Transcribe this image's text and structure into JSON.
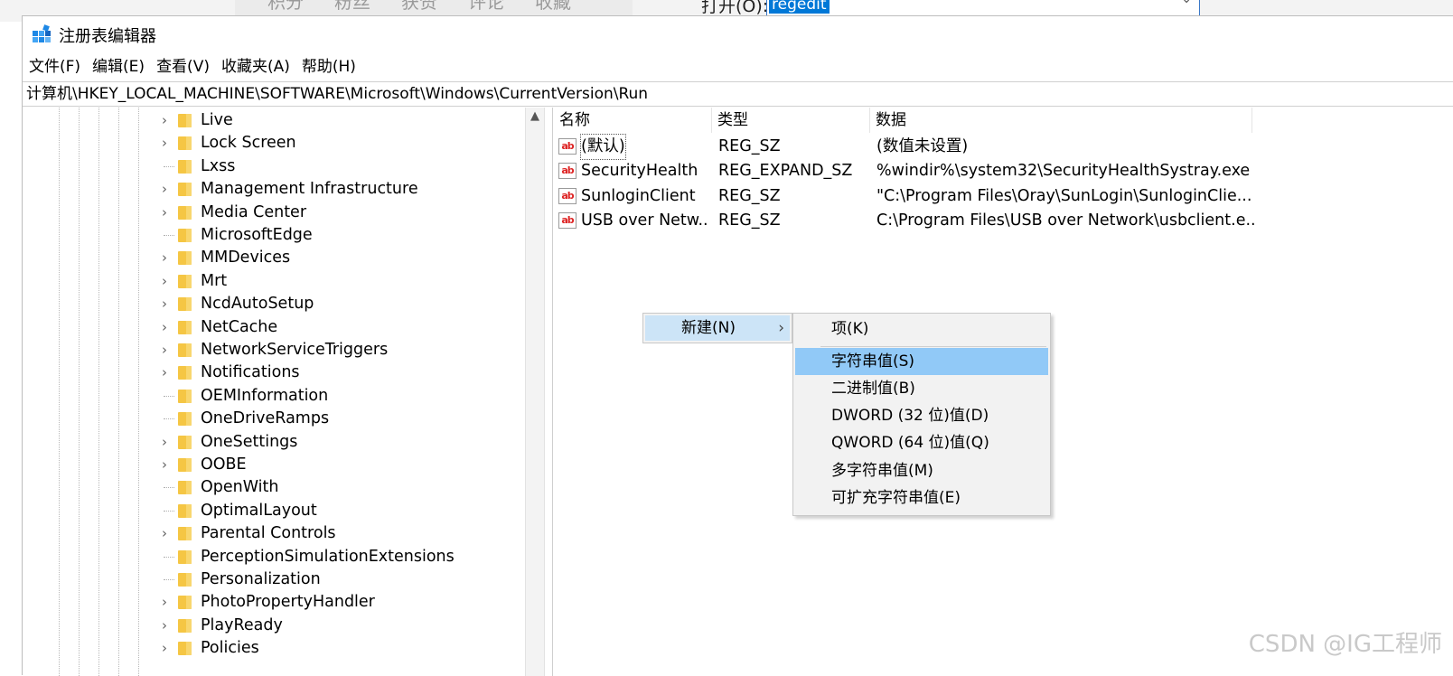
{
  "background": {
    "tabs": [
      "积分",
      "粉丝",
      "获赞",
      "评论",
      "收藏"
    ],
    "run_dialog": {
      "label": "打开(O):",
      "value": "regedit"
    }
  },
  "window": {
    "title": "注册表编辑器",
    "icon": "registry-editor-icon"
  },
  "menu": {
    "items": [
      "文件(F)",
      "编辑(E)",
      "查看(V)",
      "收藏夹(A)",
      "帮助(H)"
    ]
  },
  "address": {
    "path": "计算机\\HKEY_LOCAL_MACHINE\\SOFTWARE\\Microsoft\\Windows\\CurrentVersion\\Run"
  },
  "tree": {
    "items": [
      {
        "label": "Live",
        "expandable": true
      },
      {
        "label": "Lock Screen",
        "expandable": true
      },
      {
        "label": "Lxss",
        "expandable": false
      },
      {
        "label": "Management Infrastructure",
        "expandable": true
      },
      {
        "label": "Media Center",
        "expandable": true
      },
      {
        "label": "MicrosoftEdge",
        "expandable": false
      },
      {
        "label": "MMDevices",
        "expandable": true
      },
      {
        "label": "Mrt",
        "expandable": true
      },
      {
        "label": "NcdAutoSetup",
        "expandable": true
      },
      {
        "label": "NetCache",
        "expandable": true
      },
      {
        "label": "NetworkServiceTriggers",
        "expandable": true
      },
      {
        "label": "Notifications",
        "expandable": true
      },
      {
        "label": "OEMInformation",
        "expandable": false
      },
      {
        "label": "OneDriveRamps",
        "expandable": false
      },
      {
        "label": "OneSettings",
        "expandable": true
      },
      {
        "label": "OOBE",
        "expandable": true
      },
      {
        "label": "OpenWith",
        "expandable": false
      },
      {
        "label": "OptimalLayout",
        "expandable": false
      },
      {
        "label": "Parental Controls",
        "expandable": true
      },
      {
        "label": "PerceptionSimulationExtensions",
        "expandable": false
      },
      {
        "label": "Personalization",
        "expandable": false
      },
      {
        "label": "PhotoPropertyHandler",
        "expandable": true
      },
      {
        "label": "PlayReady",
        "expandable": true
      },
      {
        "label": "Policies",
        "expandable": true
      }
    ]
  },
  "list": {
    "columns": [
      "名称",
      "类型",
      "数据"
    ],
    "rows": [
      {
        "name": "(默认)",
        "type": "REG_SZ",
        "data": "(数值未设置)"
      },
      {
        "name": "SecurityHealth",
        "type": "REG_EXPAND_SZ",
        "data": "%windir%\\system32\\SecurityHealthSystray.exe"
      },
      {
        "name": "SunloginClient",
        "type": "REG_SZ",
        "data": "\"C:\\Program Files\\Oray\\SunLogin\\SunloginClie..."
      },
      {
        "name": "USB over Netw...",
        "type": "REG_SZ",
        "data": "C:\\Program Files\\USB over Network\\usbclient.e..."
      }
    ],
    "value_icon_text": "ab"
  },
  "context_menu": {
    "item": "新建(N)",
    "arrow": "›"
  },
  "submenu": {
    "items": [
      {
        "label": "项(K)",
        "highlighted": false
      },
      {
        "label": "字符串值(S)",
        "highlighted": true
      },
      {
        "label": "二进制值(B)",
        "highlighted": false
      },
      {
        "label": "DWORD (32 位)值(D)",
        "highlighted": false
      },
      {
        "label": "QWORD (64 位)值(Q)",
        "highlighted": false
      },
      {
        "label": "多字符串值(M)",
        "highlighted": false
      },
      {
        "label": "可扩充字符串值(E)",
        "highlighted": false
      }
    ]
  },
  "watermark": "CSDN @IG工程师",
  "colors": {
    "highlight": "#91c9f7",
    "hover": "#cce4f7",
    "folder": "#f5c644"
  }
}
